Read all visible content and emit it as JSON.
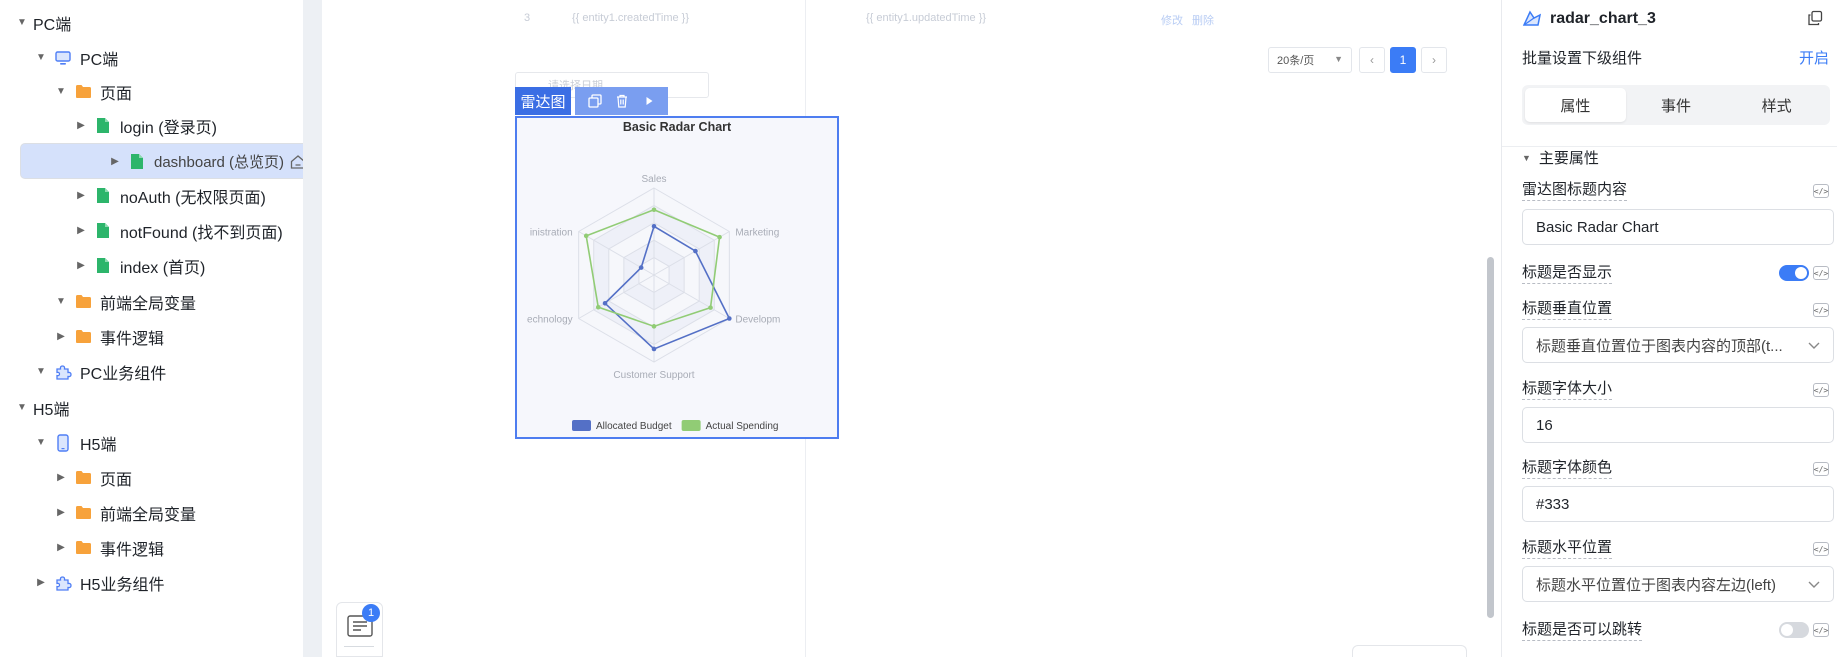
{
  "tree": {
    "items": [
      {
        "label": "PC端",
        "icon": "none",
        "expand": "down"
      },
      {
        "label": "PC端",
        "icon": "monitor-icon",
        "expand": "down"
      },
      {
        "label": "页面",
        "icon": "folder-icon",
        "expand": "down"
      },
      {
        "label": "login (登录页)",
        "icon": "page-icon",
        "expand": "right"
      },
      {
        "label": "dashboard (总览页)",
        "icon": "page-icon",
        "expand": "right",
        "selected": true,
        "home": true
      },
      {
        "label": "noAuth (无权限页面)",
        "icon": "page-icon",
        "expand": "right"
      },
      {
        "label": "notFound (找不到页面)",
        "icon": "page-icon",
        "expand": "right"
      },
      {
        "label": "index (首页)",
        "icon": "page-icon",
        "expand": "right"
      },
      {
        "label": "前端全局变量",
        "icon": "folder-icon",
        "expand": "down"
      },
      {
        "label": "事件逻辑",
        "icon": "folder-icon",
        "expand": "right"
      },
      {
        "label": "PC业务组件",
        "icon": "puzzle-icon",
        "expand": "down"
      },
      {
        "label": "H5端",
        "icon": "none",
        "expand": "down"
      },
      {
        "label": "H5端",
        "icon": "phone-icon",
        "expand": "down"
      },
      {
        "label": "页面",
        "icon": "folder-icon",
        "expand": "right"
      },
      {
        "label": "前端全局变量",
        "icon": "folder-icon",
        "expand": "right"
      },
      {
        "label": "事件逻辑",
        "icon": "folder-icon",
        "expand": "right"
      },
      {
        "label": "H5业务组件",
        "icon": "puzzle-icon",
        "expand": "right"
      }
    ]
  },
  "canvas": {
    "table_row_no": "3",
    "created_time": "{{ entity1.createdTime }}",
    "updated_time": "{{ entity1.updatedTime }}",
    "action_edit": "修改",
    "action_delete": "删除",
    "page_size": "20条/页",
    "page_current": "1",
    "date_placeholder": "请选择日期",
    "component_tag": "雷达图"
  },
  "float": {
    "badge": "1"
  },
  "chart_data": {
    "type": "radar",
    "title": "Basic Radar Chart",
    "indicators": [
      {
        "name": "Sales",
        "label": "Sales",
        "max": 100
      },
      {
        "name": "Marketing",
        "label": "Marketing",
        "max": 100
      },
      {
        "name": "Development",
        "label": "Developm",
        "max": 100
      },
      {
        "name": "Customer Support",
        "label": "Customer Support",
        "max": 100
      },
      {
        "name": "Technology",
        "label": "echnology",
        "max": 100
      },
      {
        "name": "Administration",
        "label": "inistration",
        "max": 100
      }
    ],
    "series": [
      {
        "name": "Allocated Budget",
        "color": "#5470c6",
        "values": [
          56,
          55,
          100,
          85,
          65,
          17
        ]
      },
      {
        "name": "Actual Spending",
        "color": "#91cc75",
        "values": [
          75,
          87,
          75,
          59,
          74,
          90
        ]
      }
    ],
    "legend_position": "bottom",
    "split_number": 5
  },
  "panel": {
    "component_name": "radar_chart_3",
    "batch_label": "批量设置下级组件",
    "batch_action": "开启",
    "tabs": [
      "属性",
      "事件",
      "样式"
    ],
    "active_tab": 0,
    "section_title": "主要属性",
    "code_glyph": "</>",
    "fields": {
      "title_content_label": "雷达图标题内容",
      "title_content_value": "Basic Radar Chart",
      "title_show_label": "标题是否显示",
      "title_show_value": true,
      "title_vpos_label": "标题垂直位置",
      "title_vpos_value": "标题垂直位置位于图表内容的顶部(t...",
      "title_size_label": "标题字体大小",
      "title_size_value": "16",
      "title_color_label": "标题字体颜色",
      "title_color_value": "#333",
      "title_hpos_label": "标题水平位置",
      "title_hpos_value": "标题水平位置位于图表内容左边(left)",
      "title_link_label": "标题是否可以跳转",
      "title_link_value": false
    }
  },
  "colors": {
    "accent": "#3b7cf6",
    "selected_bg": "#d5e1fb",
    "folder": "#f7a23b",
    "page": "#2db56b",
    "puzzle": "#4f7ef5"
  }
}
